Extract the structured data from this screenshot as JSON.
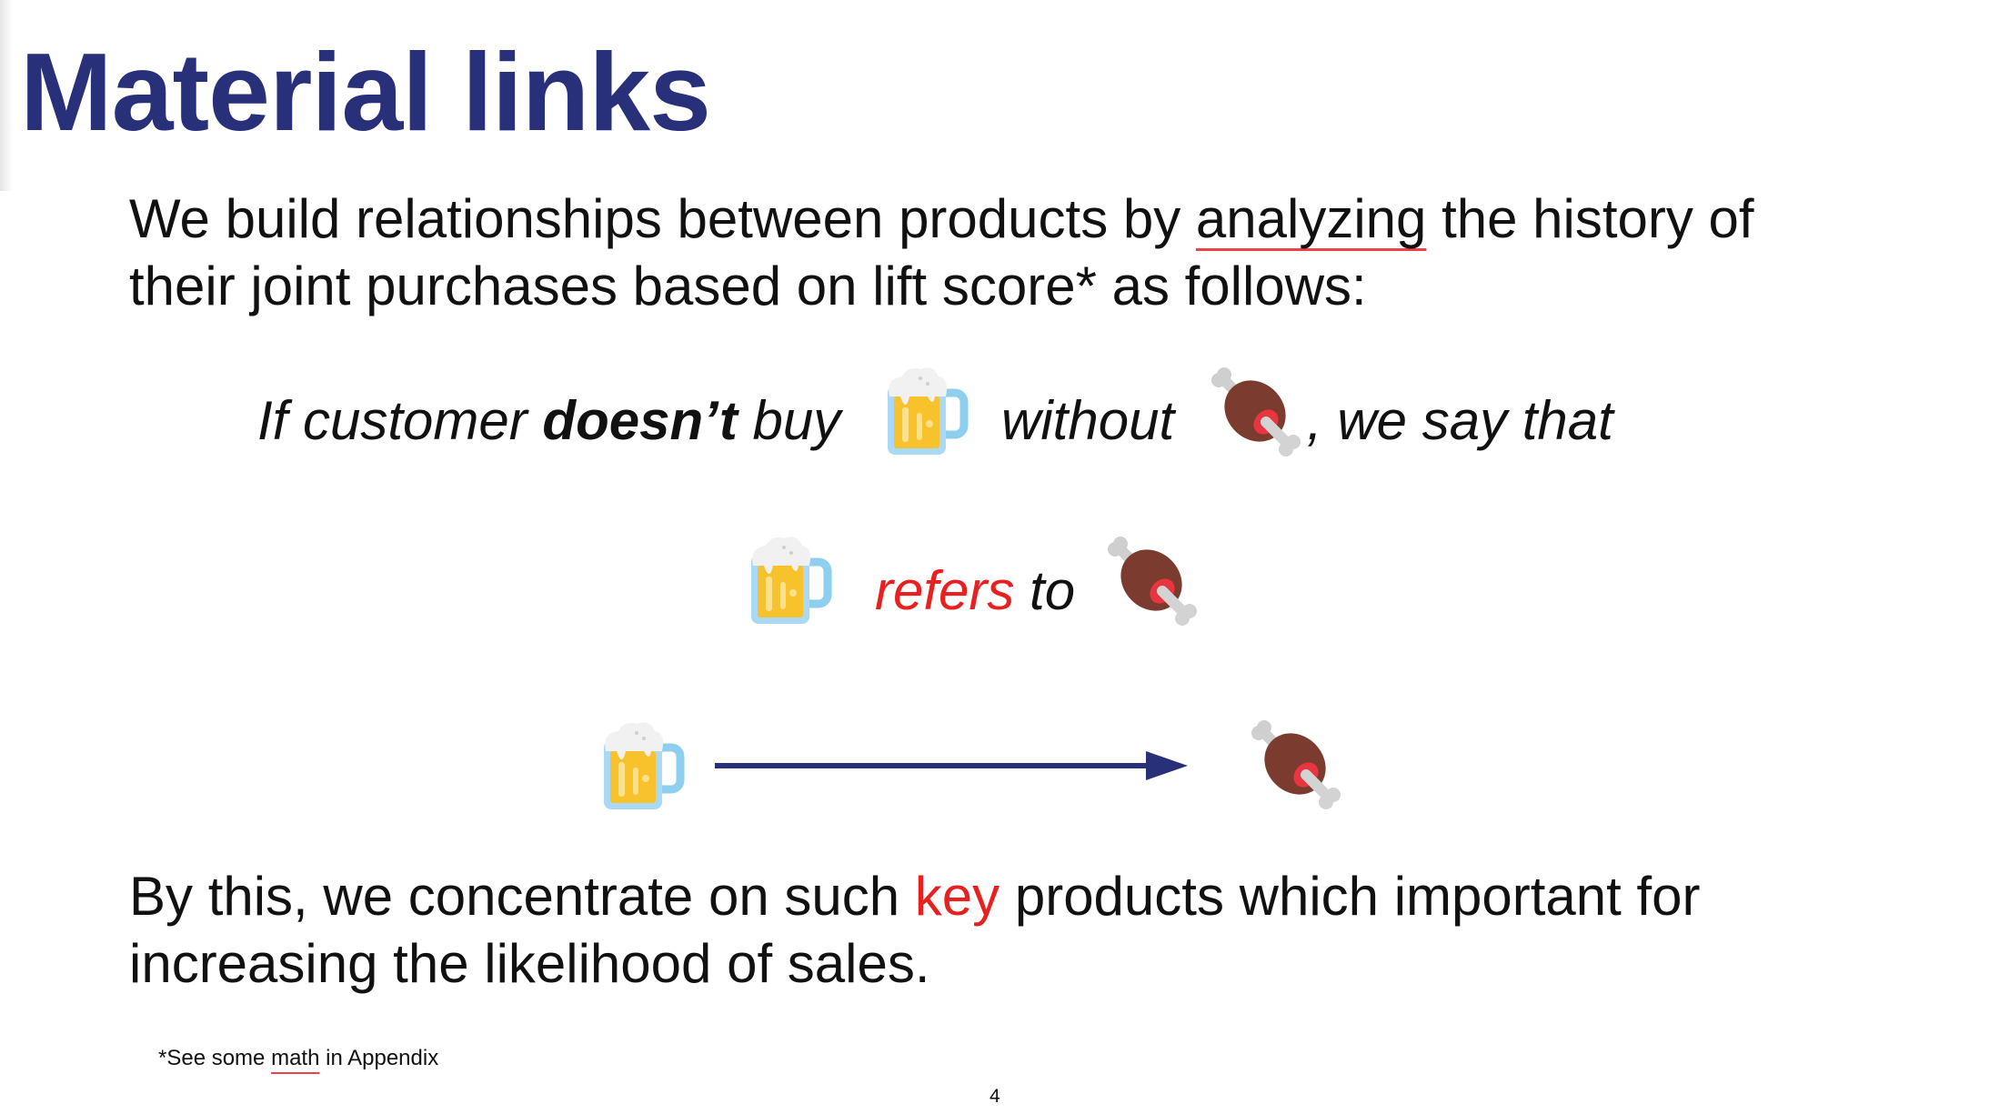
{
  "slide": {
    "title": "Material links",
    "intro": {
      "before": "We build relationships between products by ",
      "highlight": "analyzing",
      "after_line1": " the history of",
      "line2": "their joint purchases based on lift score* as follows:"
    },
    "rule": {
      "part1": "If customer ",
      "bold": "doesn’t",
      "part2": " buy",
      "without": "without",
      "we_say": ", we say that"
    },
    "refers": {
      "word": "refers",
      "to": "to"
    },
    "diagram": {
      "from_icon": "beer-mug-icon",
      "to_icon": "meat-on-bone-icon",
      "arrow_color": "#28307a"
    },
    "conclusion": {
      "before": "By this, we concentrate on such ",
      "key": "key",
      "after_line1": " products which important for",
      "line2": "increasing the likelihood of sales."
    },
    "footnote": {
      "before": "*See some ",
      "math": "math",
      "after": " in Appendix"
    },
    "page_number": "4"
  },
  "colors": {
    "title": "#28307a",
    "accent_red": "#e82020",
    "spell_underline": "#e8424a"
  }
}
